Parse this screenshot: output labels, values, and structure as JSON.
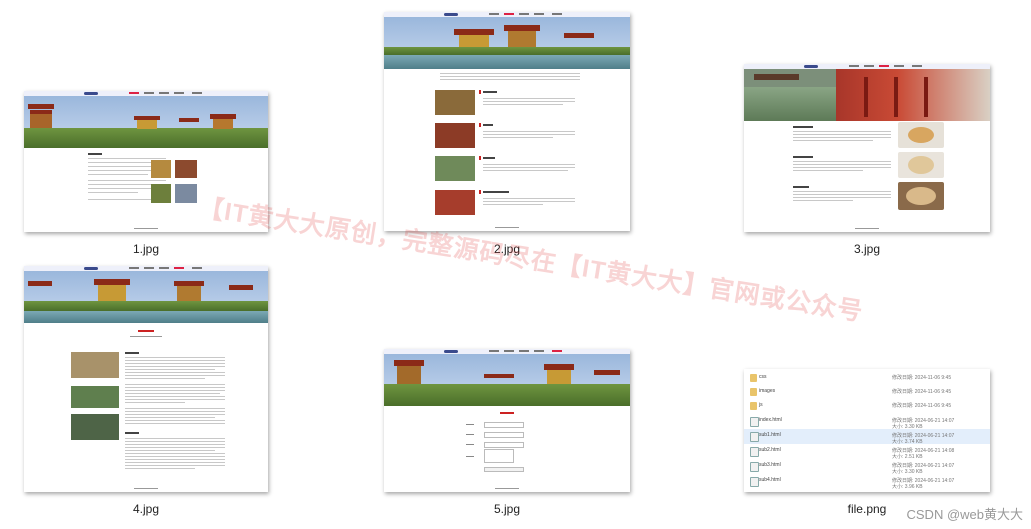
{
  "thumbnails": [
    {
      "caption": "1.jpg"
    },
    {
      "caption": "2.jpg"
    },
    {
      "caption": "3.jpg"
    },
    {
      "caption": "4.jpg"
    },
    {
      "caption": "5.jpg"
    },
    {
      "caption": "file.png"
    }
  ],
  "watermark": "【IT黄大大原创，完整源码尽在【IT黄大大】官网或公众号",
  "corner_credit": "CSDN @web黄大大",
  "file_list": [
    {
      "name": "css",
      "date": "修改日期: 2024-11-06 9:45",
      "size": ""
    },
    {
      "name": "images",
      "date": "修改日期: 2024-11-06 9:45",
      "size": ""
    },
    {
      "name": "js",
      "date": "修改日期: 2024-11-06 9:45",
      "size": ""
    },
    {
      "name": "index.html",
      "date": "修改日期: 2024-06-21 14:07",
      "size": "大小: 3.30 KB"
    },
    {
      "name": "sub1.html",
      "date": "修改日期: 2024-06-21 14:07",
      "size": "大小: 3.74 KB"
    },
    {
      "name": "sub2.html",
      "date": "修改日期: 2024-06-21 14:08",
      "size": "大小: 2.51 KB"
    },
    {
      "name": "sub3.html",
      "date": "修改日期: 2024-06-21 14:07",
      "size": "大小: 3.30 KB"
    },
    {
      "name": "sub4.html",
      "date": "修改日期: 2024-06-21 14:07",
      "size": "大小: 3.96 KB"
    }
  ],
  "colors": {
    "accent": "#d22a2a",
    "nav_bg": "#eef0fa",
    "selection": "#e3eefb"
  }
}
